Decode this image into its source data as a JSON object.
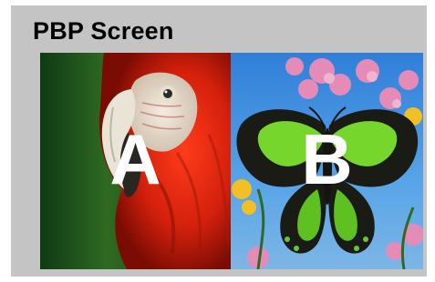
{
  "screen": {
    "title": "PBP Screen",
    "windows": [
      {
        "label": "A",
        "subject": "parrot"
      },
      {
        "label": "B",
        "subject": "butterfly"
      }
    ]
  },
  "colors": {
    "panel": "#c4c4c4",
    "label": "#ffffff",
    "title": "#000000"
  }
}
